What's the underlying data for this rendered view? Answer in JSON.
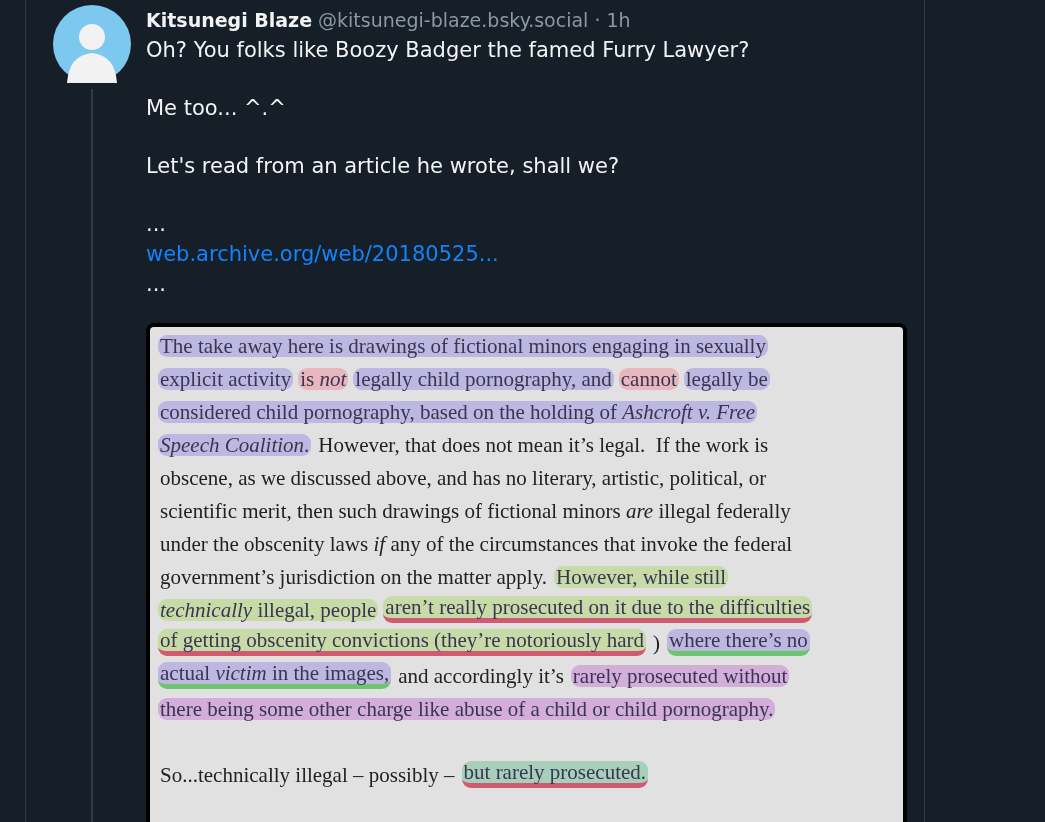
{
  "post": {
    "author": "Kitsunegi Blaze",
    "handle": "@kitsunegi-blaze.bsky.social",
    "separator": "·",
    "time": "1h",
    "paragraphs": [
      [
        {
          "kind": "text",
          "text": "Oh? You folks like Boozy Badger the famed Furry Lawyer?"
        }
      ],
      [
        {
          "kind": "text",
          "text": "Me too... ^.^"
        }
      ],
      [
        {
          "kind": "text",
          "text": "Let's read from an article he wrote, shall we?"
        }
      ],
      [
        {
          "kind": "text",
          "text": "..."
        },
        {
          "kind": "link",
          "text": "web.archive.org/web/20180525..."
        },
        {
          "kind": "text",
          "text": "..."
        }
      ]
    ],
    "document": {
      "paragraphs": [
        [
          [
            {
              "text": "The take away here is drawings of fictional minors engaging in sexually",
              "color": "#bdb8e2"
            }
          ],
          [
            {
              "text": "explicit activity",
              "color": "#bdb8e2"
            },
            {
              "text": "is *not*",
              "color": "#e8b6bf"
            },
            {
              "text": "legally child pornography, and",
              "color": "#bdb8e2"
            },
            {
              "text": "cannot",
              "color": "#e8b6bf"
            },
            {
              "text": "legally be",
              "color": "#bdb8e2"
            }
          ],
          [
            {
              "text": "considered child pornography, based on the holding of *Ashcroft v. Free*",
              "color": "#bdb8e2"
            }
          ],
          [
            {
              "text": "*Speech Coalition*.",
              "color": "#bdb8e2"
            },
            {
              "text": "However, that does not mean it’s legal.  If the work is"
            }
          ],
          [
            {
              "text": "obscene, as we discussed above, and has no literary, artistic, political, or"
            }
          ],
          [
            {
              "text": "scientific merit, then such drawings of fictional minors *are* illegal federally"
            }
          ],
          [
            {
              "text": "under the obscenity laws *if* any of the circumstances that invoke the federal"
            }
          ],
          [
            {
              "text": "government’s jurisdiction on the matter apply."
            },
            {
              "text": "However, while still",
              "color": "#c6dba8"
            }
          ],
          [
            {
              "text": "*technically* illegal, people",
              "color": "#c6dba8"
            },
            {
              "text": "aren’t really prosecuted on it due to the difficulties",
              "color": "#c6dba8",
              "underline": {
                "color": "#d25a70"
              }
            }
          ],
          [
            {
              "text": "of getting obscenity convictions (they’re notoriously hard",
              "color": "#c6dba8",
              "underline": {
                "color": "#d25a70"
              }
            },
            {
              "text": ")"
            },
            {
              "text": "where there’s no",
              "color": "#bdb8e2",
              "underline": {
                "color": "#6cc56f"
              }
            }
          ],
          [
            {
              "text": "actual *victim* in the images,",
              "color": "#bdb8e2",
              "underline": {
                "color": "#6cc56f"
              }
            },
            {
              "text": "and accordingly it’s"
            },
            {
              "text": "rarely prosecuted without",
              "color": "#d4aedb"
            }
          ],
          [
            {
              "text": "there being some other charge like abuse of a child or child pornography.",
              "color": "#d4aedb"
            }
          ]
        ],
        [
          [
            {
              "text": "So...technically illegal – possibly –"
            },
            {
              "text": "but rarely prosecuted.",
              "color": "#a8cfbb",
              "underline": {
                "color": "#d25a70"
              }
            }
          ]
        ]
      ]
    }
  }
}
